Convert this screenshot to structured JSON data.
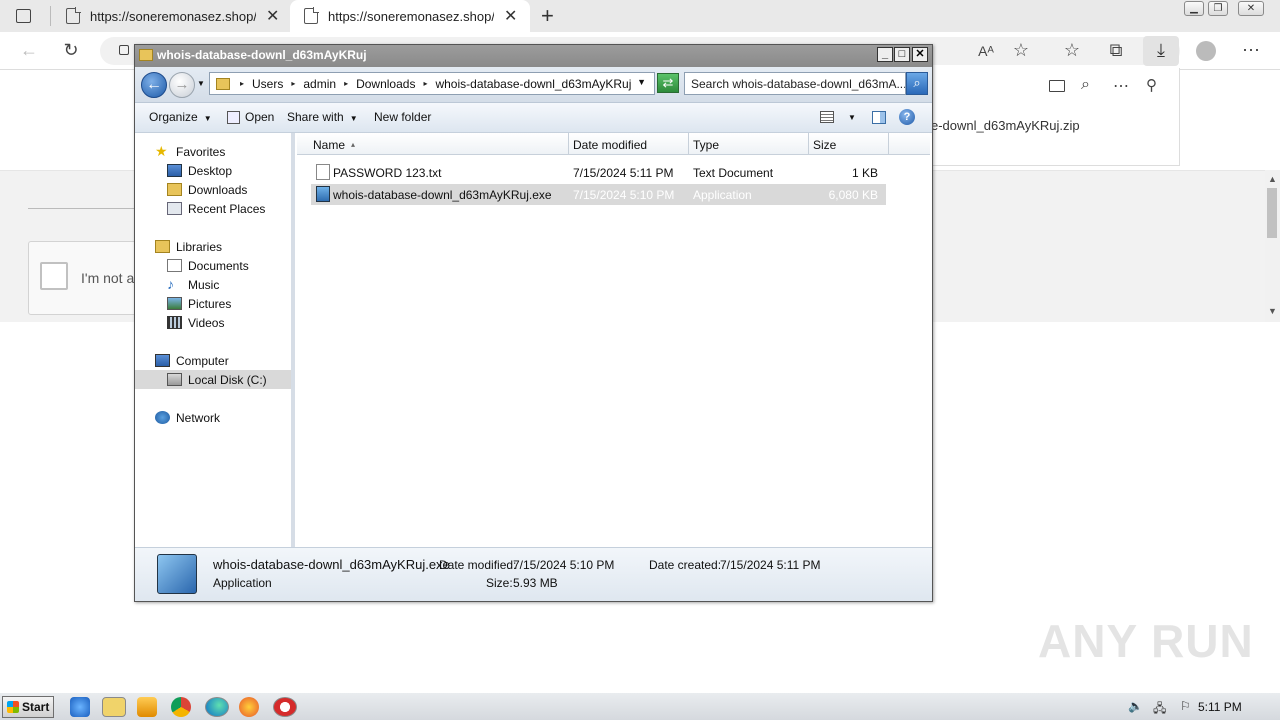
{
  "browser": {
    "tabs": [
      {
        "title": "https://soneremonasez.shop/d"
      },
      {
        "title": "https://soneremonasez.shop/d"
      }
    ],
    "new_tab_label": "+",
    "download_panel": {
      "file_name": "e-downl_d63mAyKRuj.zip"
    },
    "page": {
      "captcha_text": "I'm not a"
    }
  },
  "explorer": {
    "title": "whois-database-downl_d63mAyKRuj",
    "breadcrumb": [
      "Users",
      "admin",
      "Downloads",
      "whois-database-downl_d63mAyKRuj"
    ],
    "search_placeholder": "Search whois-database-downl_d63mA...",
    "toolbar": {
      "organize": "Organize",
      "open": "Open",
      "share_with": "Share with",
      "new_folder": "New folder"
    },
    "nav": {
      "favorites": "Favorites",
      "desktop": "Desktop",
      "downloads": "Downloads",
      "recent": "Recent Places",
      "libraries": "Libraries",
      "documents": "Documents",
      "music": "Music",
      "pictures": "Pictures",
      "videos": "Videos",
      "computer": "Computer",
      "local_disk": "Local Disk (C:)",
      "network": "Network"
    },
    "columns": {
      "name": "Name",
      "date": "Date modified",
      "type": "Type",
      "size": "Size"
    },
    "files": [
      {
        "name": "PASSWORD 123.txt",
        "date": "7/15/2024 5:11 PM",
        "type": "Text Document",
        "size": "1 KB"
      },
      {
        "name": "whois-database-downl_d63mAyKRuj.exe",
        "date": "7/15/2024 5:10 PM",
        "type": "Application",
        "size": "6,080 KB"
      }
    ],
    "details": {
      "name": "whois-database-downl_d63mAyKRuj.exe",
      "type": "Application",
      "modified_label": "Date modified:",
      "modified": "7/15/2024 5:10 PM",
      "created_label": "Date created:",
      "created": "7/15/2024 5:11 PM",
      "size_label": "Size:",
      "size": "5.93 MB"
    }
  },
  "watermark": "ANY RUN",
  "taskbar": {
    "start": "Start",
    "clock": "5:11 PM"
  }
}
